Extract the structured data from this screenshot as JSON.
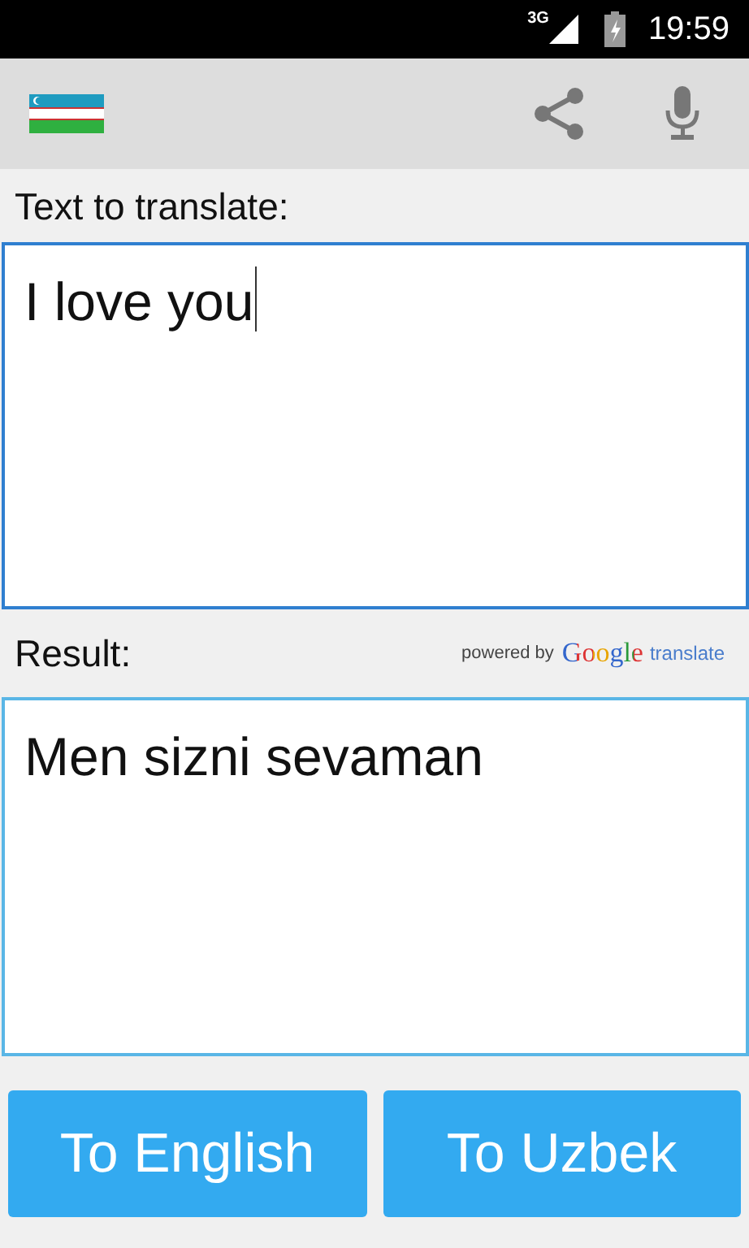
{
  "status_bar": {
    "network": "3G",
    "time": "19:59"
  },
  "source": {
    "label": "Text to translate:",
    "value": "I love you",
    "focused": true
  },
  "result": {
    "label": "Result:",
    "powered_by": "powered by",
    "brand": "Google",
    "brand_suffix": "translate",
    "value": "Men sizni sevaman"
  },
  "buttons": [
    {
      "label": "To English"
    },
    {
      "label": "To Uzbek"
    }
  ]
}
